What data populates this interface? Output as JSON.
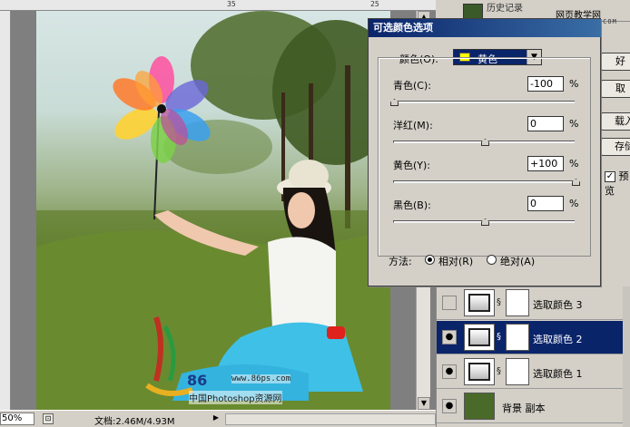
{
  "canvas": {
    "ruler_top_ticks": [
      "35",
      "",
      "",
      "",
      "",
      "25"
    ],
    "ruler_left_ticks": [
      "",
      "",
      "",
      "",
      ""
    ],
    "watermark": {
      "brand": "86",
      "url": "www.86ps.com",
      "caption": "中国Photoshop资源网"
    }
  },
  "statusbar": {
    "zoom": "50%",
    "doc_info": "文档:2.46M/4.93M"
  },
  "history": {
    "tab_label": "历史记录",
    "site_name": "网页教学网",
    "site_url": "WWW.WEB3X.COM"
  },
  "dialog": {
    "title": "可选颜色选项",
    "color_label": "颜色(O):",
    "color_value": "黄色",
    "swatch_color": "#ffff00",
    "sliders": [
      {
        "label": "青色(C):",
        "value": "-100",
        "unit": "%",
        "position": 0.0
      },
      {
        "label": "洋红(M):",
        "value": "0",
        "unit": "%",
        "position": 0.5
      },
      {
        "label": "黄色(Y):",
        "value": "+100",
        "unit": "%",
        "position": 1.0
      },
      {
        "label": "黑色(B):",
        "value": "0",
        "unit": "%",
        "position": 0.5
      }
    ],
    "method_label": "方法:",
    "method_options": [
      {
        "label": "相对(R)",
        "checked": true
      },
      {
        "label": "绝对(A)",
        "checked": false
      }
    ]
  },
  "side_buttons": {
    "ok": "好",
    "cancel": "取",
    "load": "载入",
    "save": "存储",
    "preview_label": "预览",
    "preview_checked": true
  },
  "layers": [
    {
      "name": "选取颜色 3",
      "visible": false,
      "selected": false
    },
    {
      "name": "选取颜色 2",
      "visible": true,
      "selected": true
    },
    {
      "name": "选取颜色 1",
      "visible": true,
      "selected": false
    },
    {
      "name": "背景 副本",
      "visible": true,
      "selected": false
    }
  ],
  "colors": {
    "selection_blue": "#0a246a",
    "dialog_bg": "#d4d0c8"
  }
}
